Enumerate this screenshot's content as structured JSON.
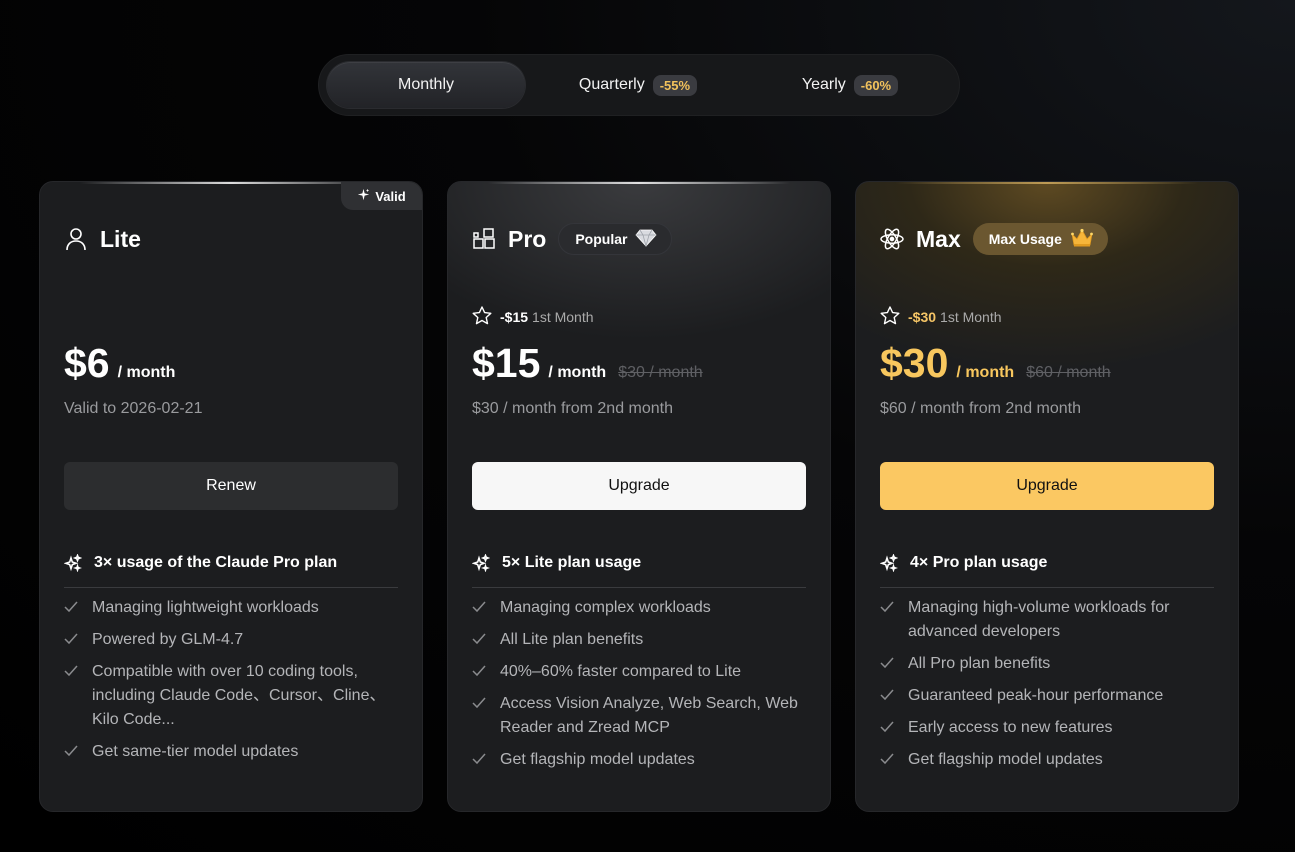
{
  "toggle": {
    "monthly": "Monthly",
    "quarterly": "Quarterly",
    "quarterly_discount": "-55%",
    "yearly": "Yearly",
    "yearly_discount": "-60%"
  },
  "plans": [
    {
      "name": "Lite",
      "icon": "user-icon",
      "tag": "Valid",
      "price": "$6",
      "per": "/ month",
      "subtext": "Valid to 2026-02-21",
      "cta": "Renew",
      "feature_head": "3× usage of the Claude Pro plan",
      "features": [
        "Managing lightweight workloads",
        "Powered by GLM-4.7",
        "Compatible with over 10 coding tools, including Claude Code、Cursor、Cline、Kilo Code...",
        "Get same-tier model updates"
      ]
    },
    {
      "name": "Pro",
      "icon": "blocks-icon",
      "badge": "Popular",
      "badge_icon": "diamond-icon",
      "promo_amount": "-$15",
      "promo_label": "1st Month",
      "price": "$15",
      "per": "/ month",
      "original": "$30 / month",
      "subtext": "$30 / month from 2nd month",
      "cta": "Upgrade",
      "feature_head": "5× Lite plan usage",
      "features": [
        "Managing complex workloads",
        "All Lite plan benefits",
        "40%–60% faster compared to Lite",
        "Access Vision Analyze, Web Search, Web Reader and Zread MCP",
        "Get flagship model updates"
      ]
    },
    {
      "name": "Max",
      "icon": "atom-icon",
      "badge": "Max Usage",
      "badge_icon": "crown-icon",
      "promo_amount": "-$30",
      "promo_label": "1st Month",
      "price": "$30",
      "per": "/ month",
      "original": "$60 / month",
      "subtext": "$60 / month from 2nd month",
      "cta": "Upgrade",
      "feature_head": "4× Pro plan usage",
      "features": [
        "Managing high-volume workloads for advanced developers",
        "All Pro plan benefits",
        "Guaranteed peak-hour performance",
        "Early access to new features",
        "Get flagship model updates"
      ]
    }
  ],
  "colors": {
    "accent_gold": "#fbc862",
    "discount": "#f2c25c",
    "card_bg": "#1c1d1f"
  }
}
